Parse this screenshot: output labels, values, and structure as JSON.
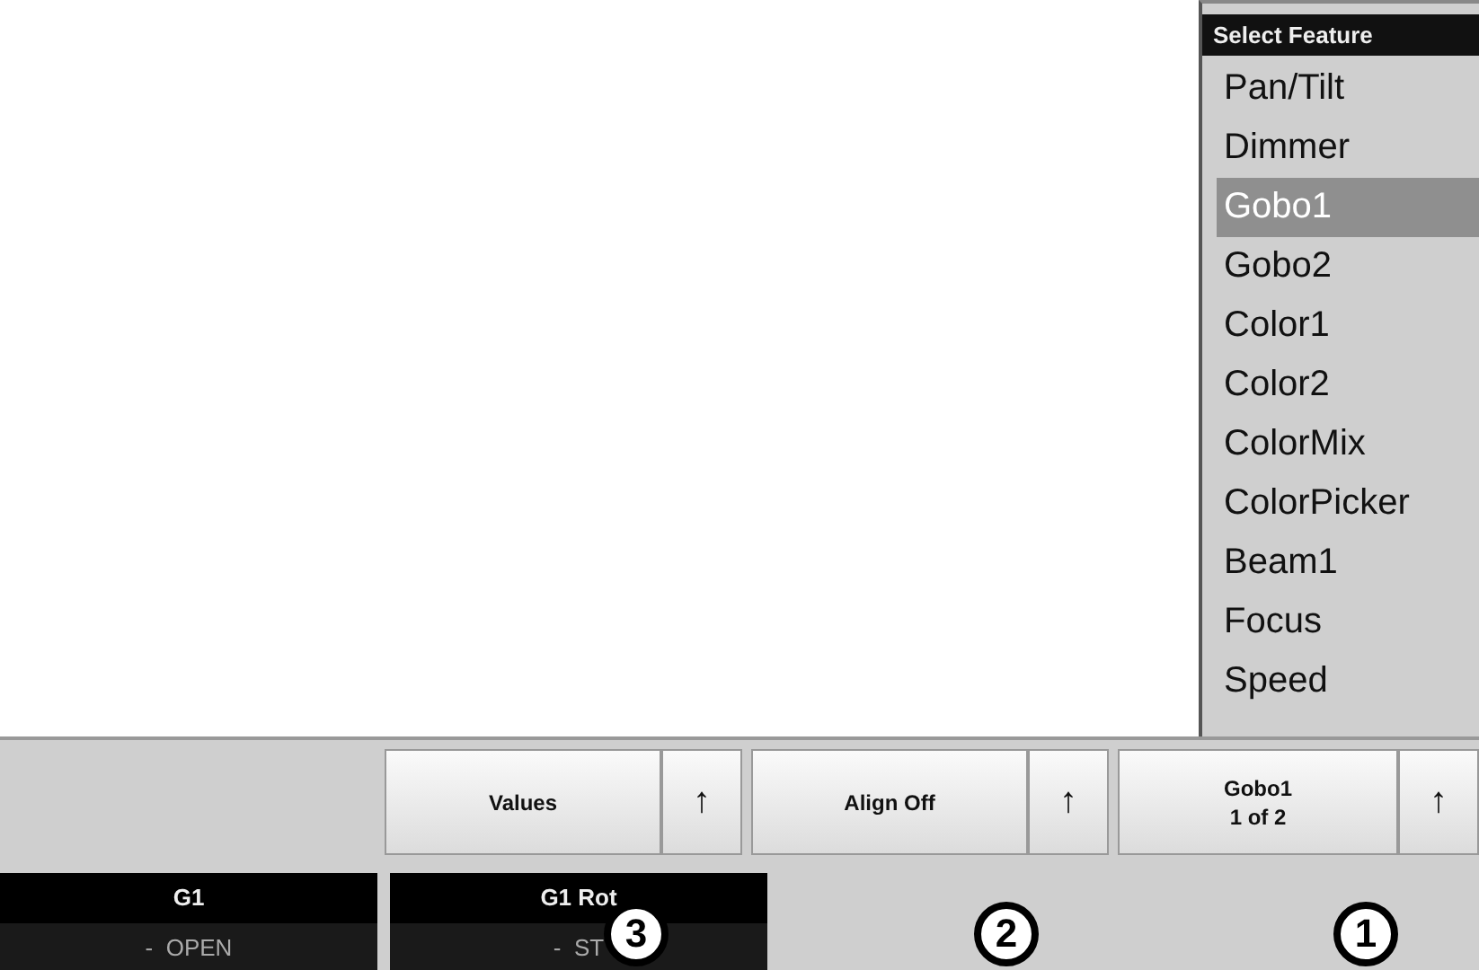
{
  "feature_menu": {
    "title": "Select Feature",
    "items": [
      {
        "label": "Pan/Tilt",
        "selected": false
      },
      {
        "label": "Dimmer",
        "selected": false
      },
      {
        "label": "Gobo1",
        "selected": true
      },
      {
        "label": "Gobo2",
        "selected": false
      },
      {
        "label": "Color1",
        "selected": false
      },
      {
        "label": "Color2",
        "selected": false
      },
      {
        "label": "ColorMix",
        "selected": false
      },
      {
        "label": "ColorPicker",
        "selected": false
      },
      {
        "label": "Beam1",
        "selected": false
      },
      {
        "label": "Focus",
        "selected": false
      },
      {
        "label": "Speed",
        "selected": false
      }
    ]
  },
  "toolbar": {
    "buttons": [
      {
        "label": "Values",
        "arrow": "↑"
      },
      {
        "label": "Align Off",
        "arrow": "↑"
      },
      {
        "label": "Gobo1",
        "sublabel": "1 of 2",
        "arrow": "↑"
      }
    ]
  },
  "encoders": [
    {
      "name": "G1",
      "value": "-  OPEN"
    },
    {
      "name": "G1 Rot",
      "value": "-  ST"
    }
  ],
  "callouts": [
    "3",
    "2",
    "1"
  ]
}
